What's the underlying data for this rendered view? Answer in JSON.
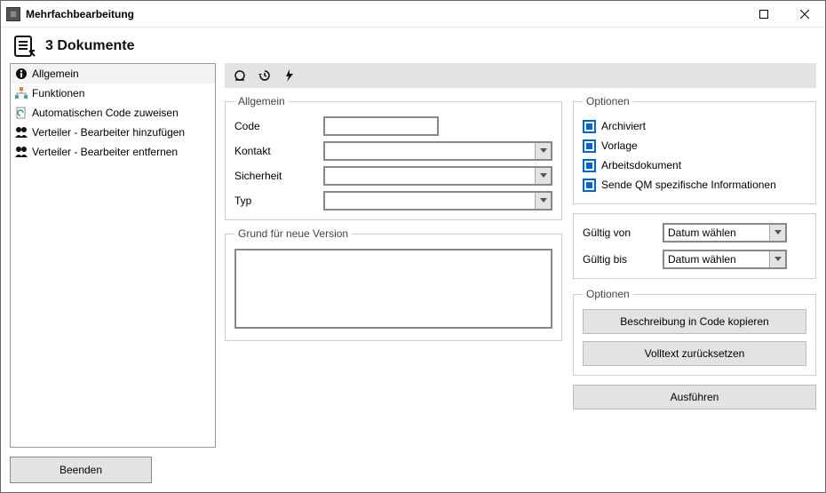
{
  "window": {
    "title": "Mehrfachbearbeitung"
  },
  "header": {
    "title": "3 Dokumente"
  },
  "nav": {
    "items": [
      {
        "label": "Allgemein"
      },
      {
        "label": "Funktionen"
      },
      {
        "label": "Automatischen Code zuweisen"
      },
      {
        "label": "Verteiler - Bearbeiter hinzufügen"
      },
      {
        "label": "Verteiler - Bearbeiter entfernen"
      }
    ]
  },
  "buttons": {
    "beenden": "Beenden",
    "copyDesc": "Beschreibung in Code kopieren",
    "resetFulltext": "Volltext zurücksetzen",
    "execute": "Ausführen"
  },
  "groups": {
    "allgemein": {
      "legend": "Allgemein",
      "code": "Code",
      "kontakt": "Kontakt",
      "sicherheit": "Sicherheit",
      "typ": "Typ"
    },
    "version": {
      "legend": "Grund für neue Version",
      "value": ""
    },
    "optionen1": {
      "legend": "Optionen",
      "archiviert": "Archiviert",
      "vorlage": "Vorlage",
      "arbeitsdokument": "Arbeitsdokument",
      "sendeQM": "Sende QM spezifische Informationen"
    },
    "validity": {
      "von": "Gültig von",
      "bis": "Gültig bis",
      "placeholder": "Datum wählen"
    },
    "optionen2": {
      "legend": "Optionen"
    }
  }
}
